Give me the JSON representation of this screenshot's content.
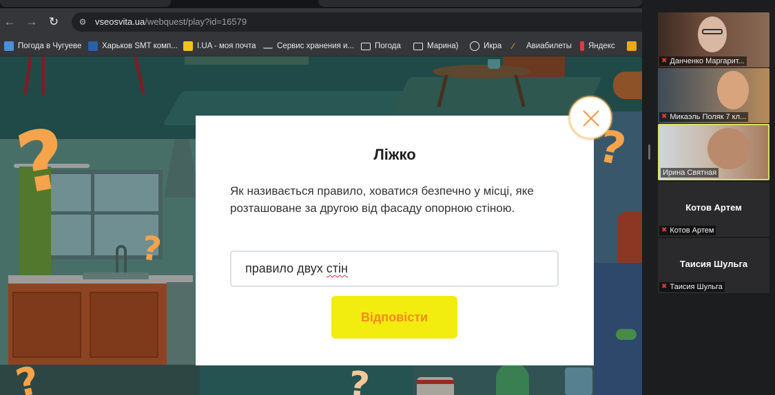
{
  "browser": {
    "url_domain": "vseosvita.ua",
    "url_path": "/webquest/play?id=16579",
    "bookmarks": [
      {
        "label": "Погода в Чугуеве",
        "icon": "weather-icon",
        "color": "#4a90d9"
      },
      {
        "label": "Харьков SMT комп...",
        "icon": "smt-icon",
        "color": "#2d5fa8"
      },
      {
        "label": "I.UA - моя почта",
        "icon": "iua-icon",
        "color": "#f0c419"
      },
      {
        "label": "Сервис хранения и...",
        "icon": "dash-icon",
        "color": "#9aa0a6"
      },
      {
        "label": "Погода",
        "icon": "folder-icon",
        "color": "#e8eaed"
      },
      {
        "label": "Марина)",
        "icon": "folder-icon",
        "color": "#e8eaed"
      },
      {
        "label": "Икра",
        "icon": "globe-icon",
        "color": "#e8eaed"
      },
      {
        "label": "Авиабилеты",
        "icon": "plane-icon",
        "color": "#f0c419"
      },
      {
        "label": "Яндекс",
        "icon": "yandex-icon",
        "color": "#e23b3b"
      }
    ]
  },
  "modal": {
    "title": "Ліжко",
    "question": "Як називається правило, ховатися безпечно у місці, яке розташоване за другою від фасаду опорною стіною.",
    "answer_prefix": "правило двух ",
    "answer_misspelled": "стін",
    "submit_label": "Відповісти",
    "accent_color": "#f2ec0f",
    "submit_text_color": "#f48a1c"
  },
  "call_panel": {
    "participants": [
      {
        "name": "Данченко Маргарит...",
        "mic": "muted",
        "video": true
      },
      {
        "name": "Микаэль Поляк 7 кл...",
        "mic": "muted",
        "video": true
      },
      {
        "name": "Ирина Святная",
        "mic": "on",
        "video": true,
        "active": true
      },
      {
        "name": "Котов Артем",
        "display_name": "Котов Артем",
        "mic": "muted",
        "video": false
      },
      {
        "name": "Таисия Шульга",
        "display_name": "Таисия Шульга",
        "mic": "muted",
        "video": false
      }
    ]
  }
}
